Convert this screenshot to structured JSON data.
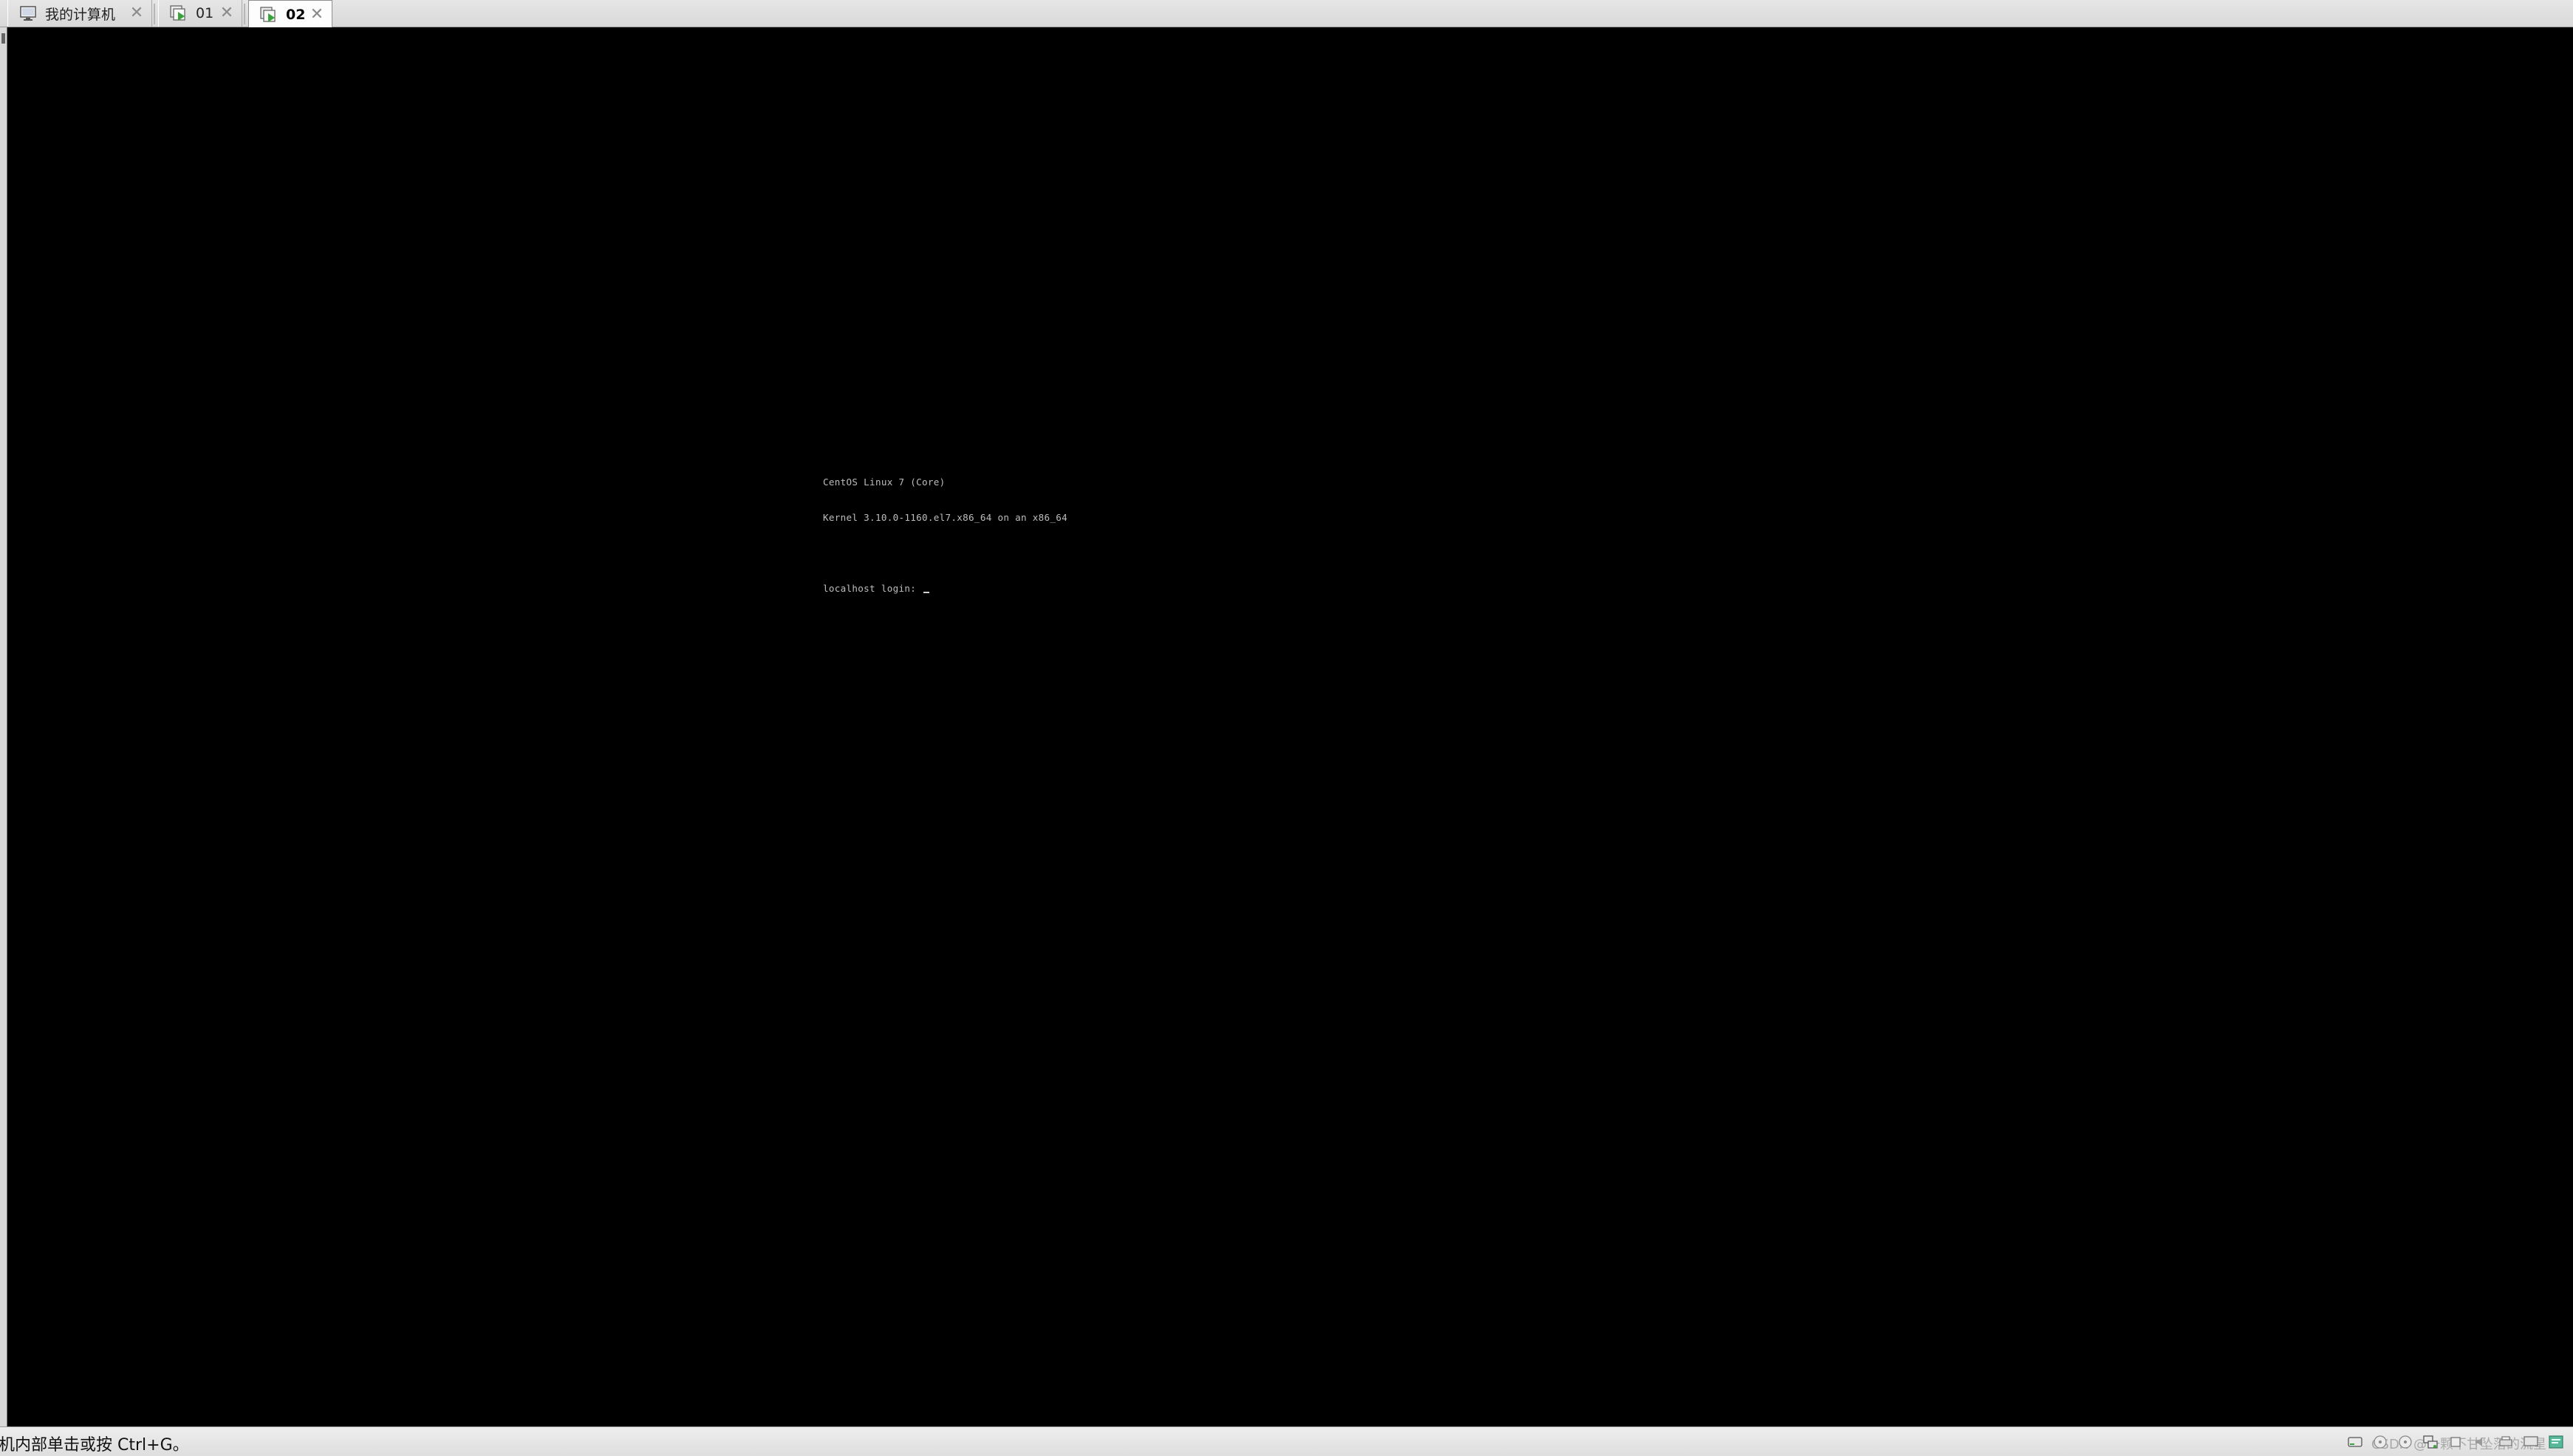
{
  "tabs": [
    {
      "label": "我的计算机",
      "icon": "computer-icon",
      "active": false
    },
    {
      "label": "01",
      "icon": "vm-running-icon",
      "active": false
    },
    {
      "label": "02",
      "icon": "vm-running-icon",
      "active": true
    }
  ],
  "console": {
    "lines": [
      "CentOS Linux 7 (Core)",
      "Kernel 3.10.0-1160.el7.x86_64 on an x86_64",
      "",
      "localhost login: "
    ]
  },
  "status": {
    "hint": "机内部单击或按 Ctrl+G。",
    "watermark": "CSDN @一颗不甘坠落的流星",
    "icons": [
      "hard-disk-icon",
      "cd-rom-icon",
      "cd-rom-icon",
      "network-adapter-icon",
      "usb-icon",
      "sound-icon",
      "printer-icon",
      "display-icon",
      "message-icon"
    ]
  },
  "colors": {
    "console_bg": "#000000",
    "console_fg": "#bdbdbd",
    "vm_icon_green": "#3aa23a"
  }
}
